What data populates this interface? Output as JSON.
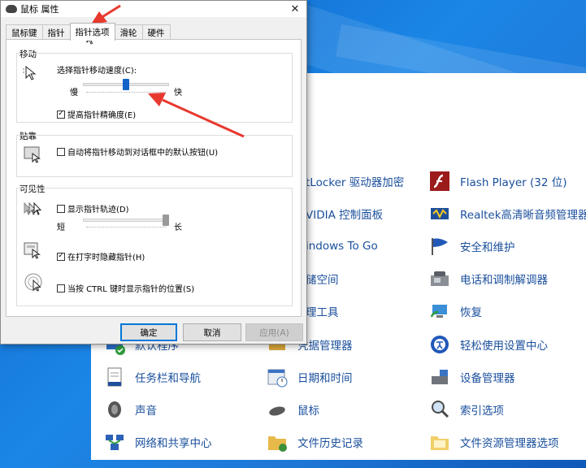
{
  "dialog": {
    "title": "鼠标 属性",
    "close_glyph": "✕",
    "tabs": [
      "鼠标键",
      "指针",
      "指针选项",
      "滑轮",
      "硬件"
    ],
    "active_tab": "指针选项",
    "motion": {
      "group_title": "移动",
      "speed_label": "选择指针移动速度(C):",
      "slow_label": "慢",
      "fast_label": "快",
      "speed_level_fraction": 0.5,
      "precision_label": "提高指针精确度(E)",
      "precision_checked": true
    },
    "snap": {
      "group_title": "贴靠",
      "snap_label": "自动将指针移动到对话框中的默认按钮(U)",
      "snap_checked": false
    },
    "visibility": {
      "group_title": "可见性",
      "trails_label": "显示指针轨迹(D)",
      "trails_checked": false,
      "short_label": "短",
      "long_label": "长",
      "trail_level_fraction": 1.0,
      "hide_label": "在打字时隐藏指针(H)",
      "hide_checked": true,
      "ctrl_label": "当按 CTRL 键时显示指针的位置(S)",
      "ctrl_checked": false
    },
    "buttons": {
      "ok": "确定",
      "cancel": "取消",
      "apply": "应用(A)"
    },
    "checkmark_glyph": "✓"
  },
  "control_panel": {
    "col1": [
      "默认程序",
      "任务栏和导航",
      "声音",
      "网络和共享中心"
    ],
    "col2": [
      "tLocker 驱动器加密",
      "VIDIA 控制面板",
      "indows To Go",
      "储空间",
      "理工具",
      "凭据管理器",
      "日期和时间",
      "鼠标",
      "文件历史记录"
    ],
    "col3": [
      "Flash Player (32 位)",
      "Realtek高清晰音频管理器",
      "安全和维护",
      "电话和调制解调器",
      "恢复",
      "轻松使用设置中心",
      "设备管理器",
      "索引选项",
      "文件资源管理器选项"
    ]
  },
  "colors": {
    "accent": "#0078d7",
    "link": "#1a4f9c",
    "annotation_red": "#e8392f"
  }
}
